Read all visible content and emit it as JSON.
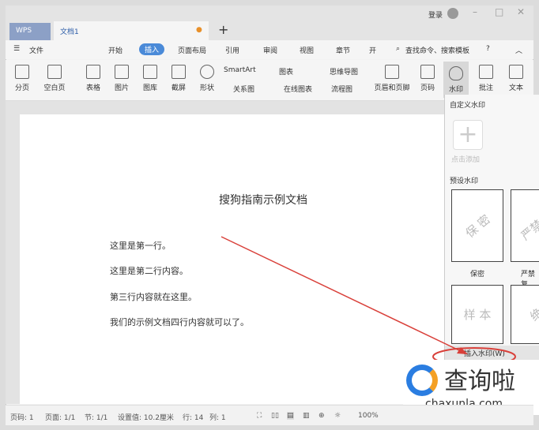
{
  "titlebar": {
    "login": "登录",
    "wps_tab": "WPS",
    "doc_tab": "文档1",
    "new_tab": "+"
  },
  "menu": {
    "file": "文件",
    "items": [
      "开始",
      "插入",
      "页面布局",
      "引用",
      "审阅",
      "视图",
      "章节",
      "开"
    ],
    "search": "查找命令、搜索模板"
  },
  "ribbon": {
    "big": [
      "分页",
      "空白页",
      "表格",
      "图片",
      "图库",
      "截屏",
      "形状"
    ],
    "small": [
      "SmartArt",
      "图表",
      "思维导图",
      "关系图",
      "在线图表",
      "流程图"
    ],
    "right": [
      "页眉和页脚",
      "页码",
      "水印",
      "批注",
      "文本"
    ]
  },
  "document": {
    "title": "搜狗指南示例文档",
    "lines": [
      "这里是第一行。",
      "这里是第二行内容。",
      "第三行内容就在这里。",
      "我们的示例文档四行内容就可以了。"
    ]
  },
  "watermark_panel": {
    "custom_header": "自定义水印",
    "add_label": "点击添加",
    "preset_header": "预设水印",
    "presets": [
      {
        "text": "保 密",
        "label": "保密"
      },
      {
        "text": "严禁复",
        "label": "严禁复"
      },
      {
        "text": "样 本",
        "label": ""
      },
      {
        "text": "绝",
        "label": ""
      }
    ],
    "insert": "插入水印(W)"
  },
  "status": {
    "page": "页码: 1",
    "pages": "页面: 1/1",
    "section": "节: 1/1",
    "setting": "设置值: 10.2厘米",
    "row": "行: 14",
    "col": "列: 1",
    "zoom": "100%",
    "zoom_level": 0.5
  },
  "overlay": {
    "logo_text": "查询啦",
    "logo_url": "chaxunla.com"
  },
  "colors": {
    "accent": "#4a8ad8",
    "arrow": "#d9403a"
  }
}
